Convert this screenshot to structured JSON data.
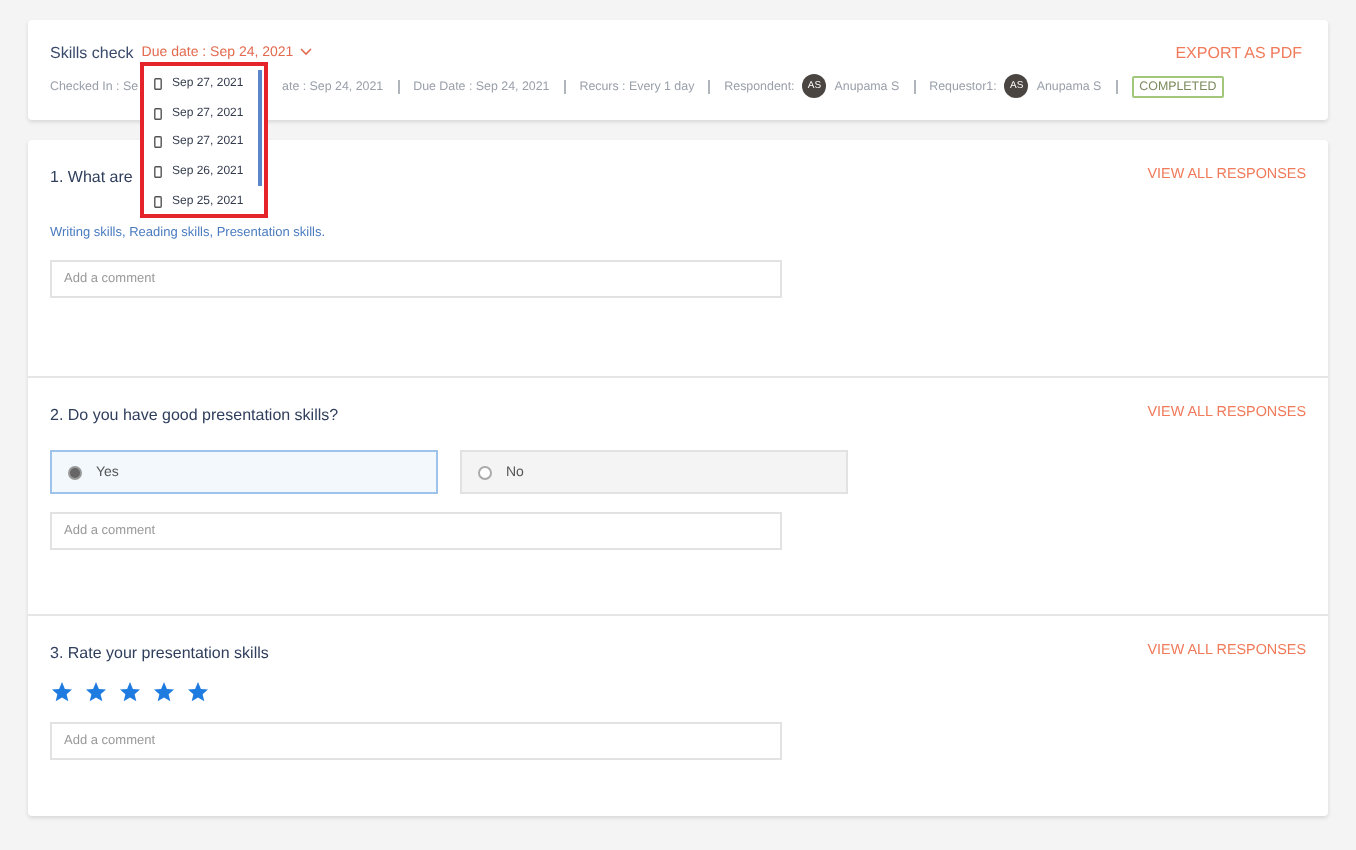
{
  "header": {
    "title": "Skills check",
    "due_date": "Due date : Sep 24, 2021",
    "export": "EXPORT AS PDF",
    "meta_start": "Checked In : Se",
    "meta_after": "ate : Sep 24, 2021",
    "due": "Due Date : Sep 24, 2021",
    "recurs": "Recurs : Every 1 day",
    "people": [
      {
        "label": "Respondent:",
        "initials": "AS",
        "name": "Anupama S"
      },
      {
        "label": "Requestor1:",
        "initials": "AS",
        "name": "Anupama S"
      }
    ],
    "status": "COMPLETED"
  },
  "dropdown": {
    "items": [
      {
        "date": "Sep 27, 2021"
      },
      {
        "date": "Sep 27, 2021"
      },
      {
        "date": "Sep 27, 2021"
      },
      {
        "date": "Sep 26, 2021"
      },
      {
        "date": "Sep 25, 2021"
      }
    ]
  },
  "questions": [
    {
      "kind": "text",
      "title": "1. What are",
      "link": "VIEW ALL RESPONSES",
      "answer": "Writing skills, Reading skills, Presentation skills.",
      "comment_placeholder": "Add a comment"
    },
    {
      "kind": "choice",
      "title": "2. Do you have good presentation skills?",
      "link": "VIEW ALL RESPONSES",
      "options": [
        {
          "label": "Yes",
          "selected": true
        },
        {
          "label": "No",
          "selected": false
        }
      ],
      "comment_placeholder": "Add a comment"
    },
    {
      "kind": "rating",
      "title": "3. Rate your presentation skills",
      "link": "VIEW ALL RESPONSES",
      "stars": 5,
      "comment_placeholder": "Add a comment"
    }
  ]
}
